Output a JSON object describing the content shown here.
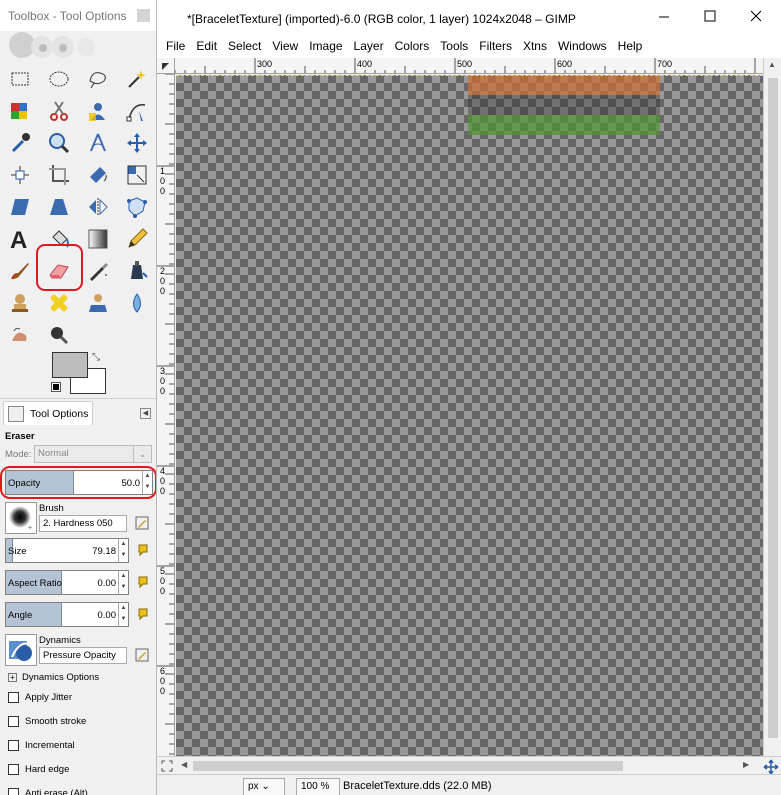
{
  "toolbox": {
    "title": "Toolbox - Tool Options",
    "tools": [
      "rect-select-icon",
      "ellipse-select-icon",
      "free-select-icon",
      "fuzzy-select-icon",
      "select-by-color-icon",
      "scissors-select-icon",
      "foreground-select-icon",
      "paths-icon",
      "color-picker-icon",
      "zoom-icon",
      "measure-icon",
      "move-icon",
      "align-icon",
      "crop-icon",
      "rotate-icon",
      "scale-icon",
      "shear-icon",
      "perspective-icon",
      "flip-icon",
      "cage-transform-icon",
      "text-icon",
      "bucket-fill-icon",
      "blend-icon",
      "pencil-icon",
      "paintbrush-icon",
      "eraser-icon",
      "airbrush-icon",
      "ink-icon",
      "clone-icon",
      "heal-icon",
      "perspective-clone-icon",
      "blur-sharpen-icon",
      "smudge-icon",
      "dodge-burn-icon"
    ],
    "selected_tool": "eraser-icon",
    "colors": {
      "foreground": "#bdbdbd",
      "background": "#ffffff"
    }
  },
  "tool_options": {
    "tab_label": "Tool Options",
    "title": "Eraser",
    "mode_label": "Mode:",
    "mode_value": "Normal",
    "opacity": {
      "label": "Opacity",
      "value": "50.0",
      "fraction": 0.5
    },
    "brush": {
      "label": "Brush",
      "value": "2. Hardness 050"
    },
    "size": {
      "label": "Size",
      "value": "79.18",
      "fraction": 0.06
    },
    "aspect_ratio": {
      "label": "Aspect Ratio",
      "value": "0.00",
      "fraction": 0.5
    },
    "angle": {
      "label": "Angle",
      "value": "0.00",
      "fraction": 0.5
    },
    "dynamics": {
      "label": "Dynamics",
      "value": "Pressure Opacity"
    },
    "dynamics_options_label": "Dynamics Options",
    "checkboxes": [
      {
        "label": "Apply Jitter",
        "checked": false
      },
      {
        "label": "Smooth stroke",
        "checked": false
      },
      {
        "label": "Incremental",
        "checked": false
      },
      {
        "label": "Hard edge",
        "checked": false
      },
      {
        "label": "Anti erase  (Alt)",
        "checked": false
      }
    ]
  },
  "image_window": {
    "title": "*[BraceletTexture] (imported)-6.0 (RGB color, 1 layer) 1024x2048 – GIMP",
    "menu": [
      "File",
      "Edit",
      "Select",
      "View",
      "Image",
      "Layer",
      "Colors",
      "Tools",
      "Filters",
      "Xtns",
      "Windows",
      "Help"
    ],
    "ruler_top_labels": [
      "300",
      "400",
      "500",
      "600",
      "700"
    ],
    "ruler_left_labels": [
      "1\n0\n0",
      "2\n0\n0",
      "3\n0\n0",
      "4\n0\n0",
      "5\n0\n0",
      "6\n0\n0"
    ],
    "status": {
      "unit": "px",
      "zoom": "100 %",
      "file_info": "BraceletTexture.dds (22.0 MB)"
    }
  }
}
